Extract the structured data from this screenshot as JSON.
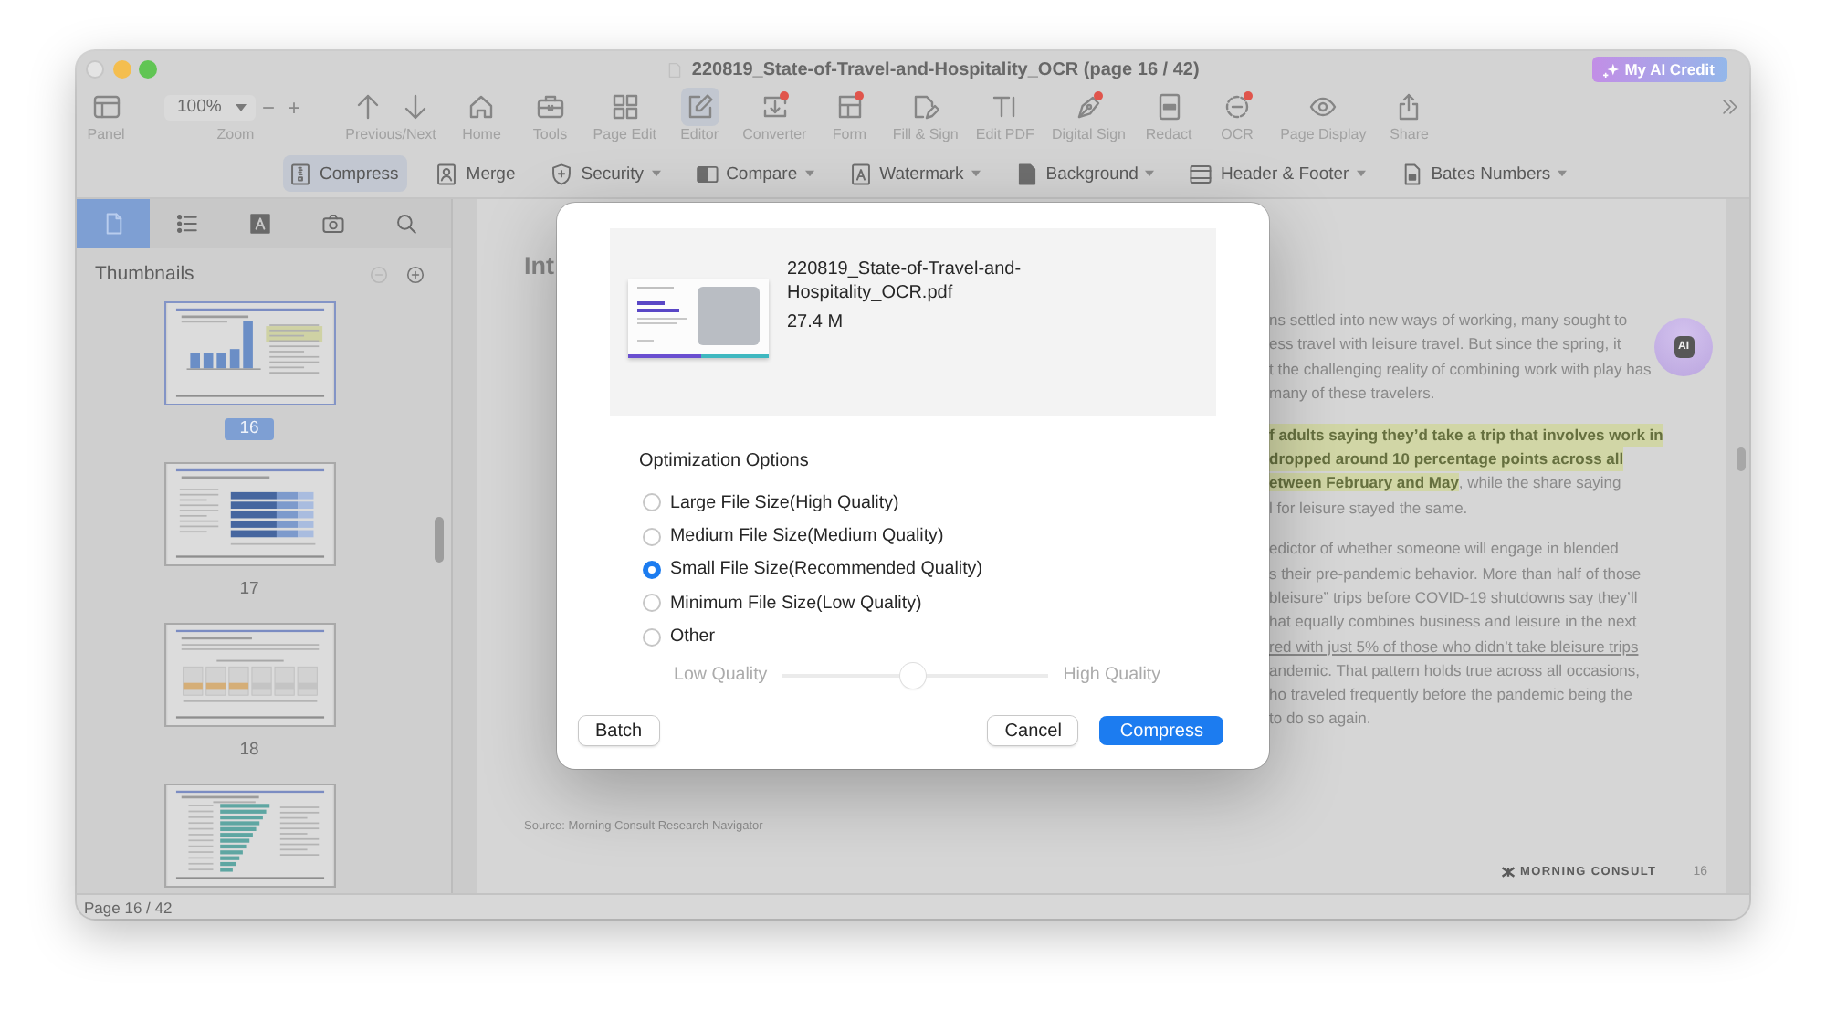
{
  "window": {
    "title": "220819_State-of-Travel-and-Hospitality_OCR (page 16 / 42)",
    "controls": [
      {
        "disabled": true
      },
      {
        "disabled": false
      },
      {
        "disabled": false
      }
    ],
    "ai_credit_button": "My AI Credit"
  },
  "toolbar": {
    "panel": "Panel",
    "zoom": {
      "value": "100%",
      "decrease": "−",
      "increase": "+",
      "label": "Zoom"
    },
    "navigation": {
      "label": "Previous/Next"
    },
    "tools": [
      {
        "label": "Home",
        "selected": false,
        "dot": false
      },
      {
        "label": "Tools",
        "selected": false,
        "dot": false
      },
      {
        "label": "Page Edit",
        "selected": false,
        "dot": false
      },
      {
        "label": "Editor",
        "selected": true,
        "dot": false
      },
      {
        "label": "Converter",
        "selected": false,
        "dot": true
      },
      {
        "label": "Form",
        "selected": false,
        "dot": true
      },
      {
        "label": "Fill & Sign",
        "selected": false,
        "dot": false
      },
      {
        "label": "Edit PDF",
        "selected": false,
        "dot": false
      },
      {
        "label": "Digital Sign",
        "selected": false,
        "dot": true
      },
      {
        "label": "Redact",
        "selected": false,
        "dot": false
      },
      {
        "label": "OCR",
        "selected": false,
        "dot": true
      },
      {
        "label": "Page Display",
        "selected": false,
        "dot": false
      },
      {
        "label": "Share",
        "selected": false,
        "dot": false
      }
    ]
  },
  "features": [
    {
      "label": "Compress",
      "selected": true,
      "dropdown": false
    },
    {
      "label": "Merge",
      "selected": false,
      "dropdown": false
    },
    {
      "label": "Security",
      "selected": false,
      "dropdown": true
    },
    {
      "label": "Compare",
      "selected": false,
      "dropdown": true
    },
    {
      "label": "Watermark",
      "selected": false,
      "dropdown": true
    },
    {
      "label": "Background",
      "selected": false,
      "dropdown": true
    },
    {
      "label": "Header & Footer",
      "selected": false,
      "dropdown": true
    },
    {
      "label": "Bates Numbers",
      "selected": false,
      "dropdown": true
    }
  ],
  "sidebar": {
    "tabs": [
      {
        "selected": true
      },
      {
        "selected": false
      },
      {
        "selected": false
      },
      {
        "selected": false
      },
      {
        "selected": false
      }
    ],
    "title": "Thumbnails",
    "zoom_buttons": [
      {
        "disabled": true
      },
      {
        "disabled": false
      }
    ],
    "thumbnails": [
      {
        "kind": "column-chart",
        "label": "16",
        "selected": true
      },
      {
        "kind": "bar-table",
        "label": "17",
        "selected": false
      },
      {
        "kind": "column-grid",
        "label": "18",
        "selected": false
      },
      {
        "kind": "bar-chart",
        "selected": false
      }
    ]
  },
  "document": {
    "heading": "Int",
    "paragraphs": [
      {
        "lines": [
          {
            "text": "ns settled into new ways of working, many sought to",
            "kind": "plain"
          },
          {
            "text": "ess travel with leisure travel. But since the spring, it",
            "kind": "plain"
          },
          {
            "text": "t the challenging reality of combining work with play has",
            "kind": "plain"
          },
          {
            "text": "many of these travelers.",
            "kind": "plain"
          }
        ]
      },
      {
        "lines": [
          {
            "text": "f adults saying they’d take a trip that involves work in",
            "kind": "highlight"
          },
          {
            "text": "dropped around 10 percentage points across all",
            "kind": "highlight"
          },
          {
            "text": "**etween February and May**, while the share saying",
            "kind": "mixed"
          },
          {
            "text": "l for leisure stayed the same.",
            "kind": "plain"
          }
        ]
      },
      {
        "lines": [
          {
            "text": "edictor of whether someone will engage in blended",
            "kind": "plain"
          },
          {
            "text": "s their pre-pandemic behavior. More than half of those",
            "kind": "plain"
          },
          {
            "text": "bleisure” trips before COVID-19 shutdowns say they’ll",
            "kind": "plain"
          },
          {
            "text": "hat equally combines business and leisure in the next",
            "kind": "plain"
          },
          {
            "text": "red with just 5% of those who didn’t take bleisure trips",
            "kind": "underline"
          },
          {
            "text": "andemic. That pattern holds true across all occasions,",
            "kind": "plain"
          },
          {
            "text": "ho traveled frequently before the pandemic being the",
            "kind": "plain"
          },
          {
            "text": "to do so again.",
            "kind": "plain"
          }
        ]
      }
    ],
    "source": "Source: Morning Consult Research Navigator",
    "logo": "MORNING CONSULT",
    "page_number": "16",
    "ai_button": "AI"
  },
  "status_bar": {
    "page": "Page 16 / 42"
  },
  "compress_dialog": {
    "file": {
      "name": "220819_State-of-Travel-and-Hospitality_OCR.pdf",
      "size": "27.4 M"
    },
    "options_title": "Optimization Options",
    "options": [
      {
        "label": "Large File Size(High Quality)",
        "selected": false
      },
      {
        "label": "Medium File Size(Medium Quality)",
        "selected": false
      },
      {
        "label": "Small File Size(Recommended Quality)",
        "selected": true
      },
      {
        "label": "Minimum File Size(Low Quality)",
        "selected": false
      },
      {
        "label": "Other",
        "selected": false
      }
    ],
    "quality_slider": {
      "min_label": "Low Quality",
      "max_label": "High Quality",
      "level": 0.49,
      "disabled": true
    },
    "footer": {
      "left": [
        {
          "label": "Batch",
          "kind": "default"
        }
      ],
      "right": [
        {
          "label": "Cancel",
          "kind": "default"
        },
        {
          "label": "Compress",
          "kind": "primary"
        }
      ]
    }
  }
}
